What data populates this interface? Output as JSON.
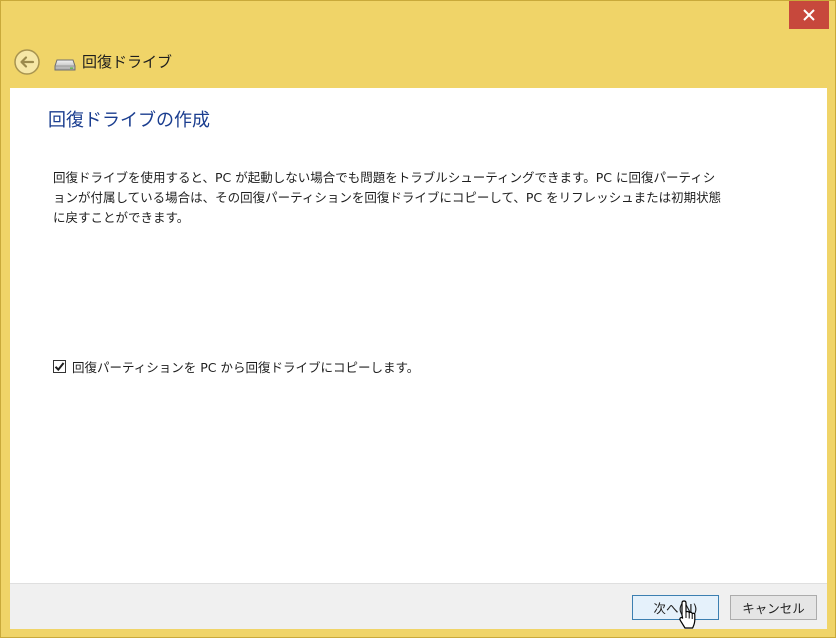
{
  "window": {
    "title": "回復ドライブ",
    "close_icon": "close-icon",
    "back_icon": "back-arrow-icon",
    "drive_icon": "drive-icon",
    "accent_color": "#f0d468"
  },
  "main": {
    "page_title": "回復ドライブの作成",
    "description": "回復ドライブを使用すると、PC が起動しない場合でも問題をトラブルシューティングできます。PC に回復パーティションが付属している場合は、その回復パーティションを回復ドライブにコピーして、PC をリフレッシュまたは初期状態に戻すことができます。",
    "copy_partition_checkbox": {
      "label": "回復パーティションを PC から回復ドライブにコピーします。",
      "checked": true
    }
  },
  "footer": {
    "next_label": "次へ(N)",
    "cancel_label": "キャンセル"
  }
}
